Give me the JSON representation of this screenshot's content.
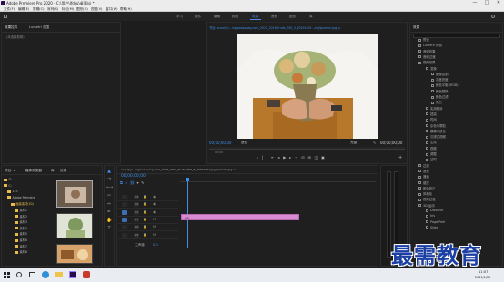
{
  "app": {
    "title": "Adobe Premiere Pro 2020 - C:\\用户\\Ifdsu\\桌面\\sj *",
    "window_controls": [
      "—",
      "□",
      "✕"
    ]
  },
  "menu": [
    "文件(F)",
    "编辑(E)",
    "剪辑(C)",
    "序列(S)",
    "标记(M)",
    "图形(G)",
    "视图(V)",
    "窗口(W)",
    "帮助(H)"
  ],
  "workspaces": {
    "items": [
      "学习",
      "组件",
      "编辑",
      "颜色",
      "效果",
      "音频",
      "图形",
      "库"
    ],
    "active": "效果"
  },
  "source_panel": {
    "tabs": [
      "效果控件",
      "Lumetri 范围"
    ],
    "message": "(未选择剪辑)"
  },
  "program": {
    "tab": "节目: zcool(ly/...ing/aaaaaaag.com_2015_2016_fruits_790_3_20191001...ing/sjzmrlm.jpg ≡",
    "timecode_left": "00;00;00;00",
    "fit": "适合",
    "timecode_right": "00;00;00;00",
    "quality": "完整",
    "scrub_time": "00;00"
  },
  "project": {
    "tabs": [
      "项目: sj",
      "媒体浏览器",
      "库",
      "信息"
    ],
    "tree": [
      "D:",
      "C:",
      "123",
      "Adobe Premiere",
      "画素素材(10)",
      "素材1",
      "素材2",
      "素材3",
      "素材4",
      "素材5",
      "素材6",
      "素材7",
      "素材8"
    ]
  },
  "timeline": {
    "tab": "zcool(ly/...ing/aaaaaaag.com_2015_2016_fruits_790_3_20191001/jpg/sjzmrlm.jpg ≡",
    "timecode": "00;00;00;00",
    "clip_label": "jpg",
    "tracks": [
      "V3",
      "V2",
      "V1",
      "A1",
      "A2",
      "A3"
    ],
    "mix_label": "主声道",
    "mix_value": "0.0"
  },
  "effects": {
    "title": "效果",
    "items": [
      "预设",
      "Lumetri 预设",
      "音频效果",
      "音频过渡",
      "视频效果",
      "变换",
      "图像控制",
      "灰度亮度",
      "颜色平衡 (RGB)",
      "颜色替换",
      "颜色过滤",
      "黑白",
      "实用程序",
      "扭曲",
      "时间",
      "杂色与颗粒",
      "模糊与锐化",
      "沉浸式视频",
      "生成",
      "视频",
      "调整",
      "过时",
      "过渡",
      "透视",
      "通道",
      "键控",
      "颜色校正",
      "风格化",
      "视频过渡",
      "3D 运动",
      "Dissolve",
      "Iris",
      "Page Peel",
      "Slide"
    ]
  },
  "watermark": "最需教育",
  "taskbar": {
    "time": "11:07",
    "date": "2021/1/29"
  }
}
